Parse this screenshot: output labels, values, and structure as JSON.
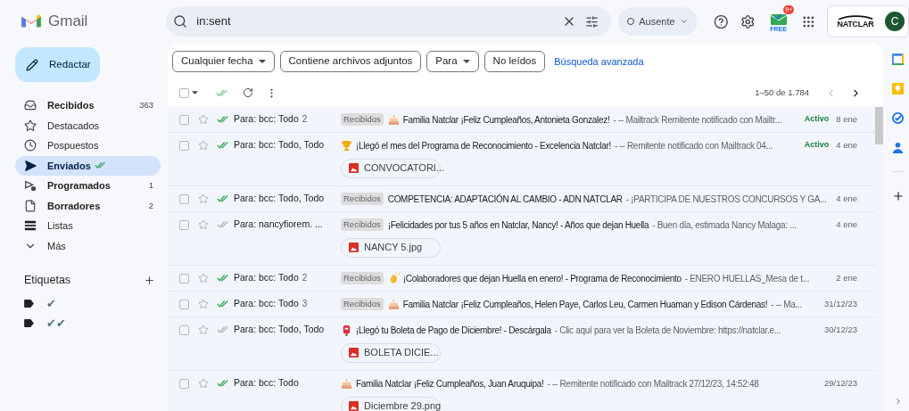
{
  "header": {
    "product": "Gmail",
    "search": {
      "value": "in:sent"
    },
    "status": "Ausente",
    "mailtrack_badge": "9+",
    "mailtrack_label": "FREE",
    "account_logo": "NATCLAR",
    "avatar": "C"
  },
  "sidebar": {
    "compose": "Redactar",
    "items": [
      {
        "kind": "inbox",
        "label": "Recibidos",
        "count": "363",
        "bold": true,
        "selected": false,
        "tracked": false
      },
      {
        "kind": "star",
        "label": "Destacados",
        "bold": false,
        "selected": false,
        "tracked": false
      },
      {
        "kind": "clock",
        "label": "Pospuestos",
        "bold": false,
        "selected": false,
        "tracked": false
      },
      {
        "kind": "send",
        "label": "Enviados",
        "bold": true,
        "selected": true,
        "tracked": true
      },
      {
        "kind": "scheduled",
        "label": "Programados",
        "count": "1",
        "bold": true,
        "selected": false,
        "tracked": false
      },
      {
        "kind": "file",
        "label": "Borradores",
        "count": "2",
        "bold": true,
        "selected": false,
        "tracked": false
      },
      {
        "kind": "lists",
        "label": "Listas",
        "bold": false,
        "selected": false,
        "tracked": false
      },
      {
        "kind": "more",
        "label": "Más",
        "bold": false,
        "selected": false,
        "tracked": false
      }
    ],
    "labels_title": "Etiquetas",
    "labels": [
      {
        "name": "✔"
      },
      {
        "name": "✔✔"
      }
    ]
  },
  "filters": [
    {
      "label": "Cualquier fecha",
      "dropdown": true
    },
    {
      "label": "Contiene archivos adjuntos",
      "dropdown": false
    },
    {
      "label": "Para",
      "dropdown": true
    },
    {
      "label": "No leídos",
      "dropdown": false
    }
  ],
  "advanced_search": "Búsqueda avanzada",
  "toolbar": {
    "select_all_checked": false,
    "range": "1–50 de 1.784"
  },
  "emails": [
    {
      "checked": false,
      "recipient": "Para: bcc: Todo",
      "count": "2",
      "opened": true,
      "label": "Recibidos",
      "kind": "cake",
      "subject": "Familia Natclar ¡Feliz Cumpleaños, Antonieta Gonzalez!",
      "snippet": "- -- Mailtrack Remitente notificado con Mailtr...",
      "status": "Activo",
      "date": "8 ene"
    },
    {
      "checked": false,
      "recipient": "Para: bcc: Todo, Todo",
      "opened": true,
      "kind": "trophy",
      "subject": "¡Llegó el mes del Programa de Reconocimiento - Excelencia Natclar!",
      "snippet": "- -- Remitente notificado con Mailtrack 04...",
      "status": "Activo",
      "date": "4 ene",
      "attachment": "CONVOCATORI..."
    },
    {
      "checked": false,
      "recipient": "Para: bcc: Todo, Todo",
      "opened": true,
      "label": "Recibidos",
      "subject": "COMPETENCIA: ADAPTACIÓN AL CAMBIO - ADN NATCLAR",
      "snippet": "- ¡PARTICIPA DE NUESTROS CONCURSOS Y GA...",
      "date": "4 ene"
    },
    {
      "checked": false,
      "recipient": "Para: nancyfiorem. ...",
      "opened": false,
      "label": "Recibidos",
      "subject": "¡Felicidades por tus 5 años en Natclar, Nancy! - Años que dejan Huella",
      "snippet": "- Buen día, estimada Nancy Malaga: ...",
      "date": "4 ene",
      "attachment": "NANCY 5.jpg"
    },
    {
      "checked": false,
      "recipient": "Para: bcc: Todo",
      "count": "2",
      "opened": true,
      "label": "Recibidos",
      "kind": "clap",
      "subject": "¡Colaboradores que dejan Huella en enero! - Programa de Reconocimiento",
      "snippet": "- ENERO HUELLAS_Mesa de t...",
      "date": "2 ene"
    },
    {
      "checked": false,
      "recipient": "Para: bcc: Todo",
      "count": "3",
      "opened": true,
      "label": "Recibidos",
      "kind": "cake",
      "subject": "Familia Natclar ¡Feliz Cumpleaños, Helen Paye, Carlos Leu, Carmen Huaman y Edison Cárdenas!",
      "snippet": "- -- Ma...",
      "date": "31/12/23"
    },
    {
      "checked": false,
      "recipient": "Para: bcc: Todo, Todo",
      "opened": false,
      "kind": "mailbox",
      "subject": "¡Llegó tu Boleta de Pago de Diciembre! - Descárgala",
      "snippet": "- Clic aquí para ver la Boleta de Noviembre: https://natclar.e...",
      "date": "30/12/23",
      "attachment": "BOLETA DICIE..."
    },
    {
      "checked": false,
      "recipient": "Para: bcc: Todo",
      "opened": true,
      "kind": "cake",
      "subject": "Familia Natclar ¡Feliz Cumpleaños, Juan Aruquipa!",
      "snippet": "- -- Remitente notificado con Mailtrack 27/12/23, 14:52:48",
      "date": "29/12/23",
      "attachment": "Diciembre 29.png"
    }
  ]
}
